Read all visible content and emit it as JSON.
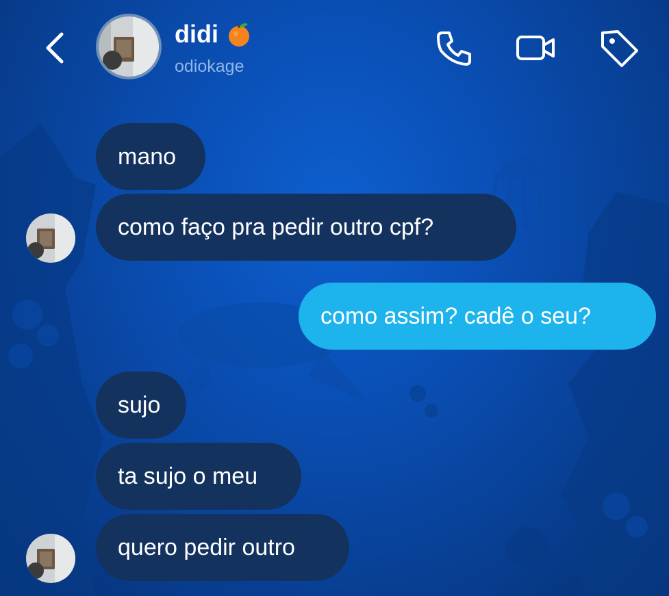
{
  "header": {
    "name": "didi",
    "emoji": "tangerine-icon",
    "username": "odiokage",
    "actions": [
      "phone-icon",
      "video-camera-icon",
      "tag-icon"
    ]
  },
  "messages": [
    {
      "side": "in",
      "text": "mano"
    },
    {
      "side": "in",
      "text": "como faço pra pedir outro cpf?"
    },
    {
      "side": "out",
      "text": "como assim? cadê o seu?"
    },
    {
      "side": "in",
      "text": "sujo"
    },
    {
      "side": "in",
      "text": "ta sujo o meu"
    },
    {
      "side": "in",
      "text": "quero pedir outro"
    }
  ],
  "colors": {
    "incoming_bubble": "#14325e",
    "outgoing_bubble": "#1db3ec",
    "background": "#0a4fb5"
  }
}
